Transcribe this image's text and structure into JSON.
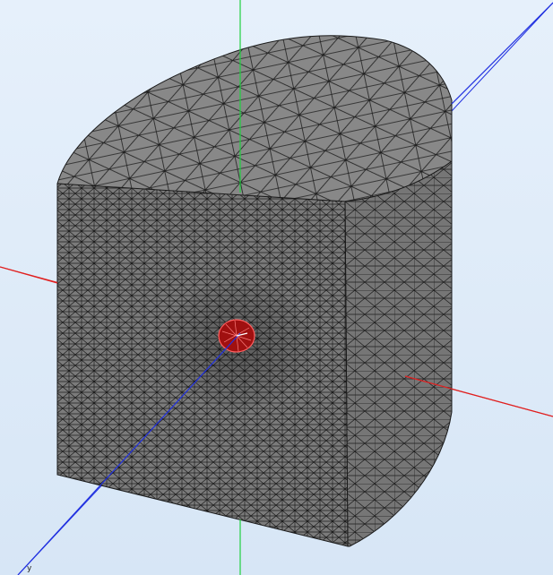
{
  "viewport": {
    "background": "#dde9f7"
  },
  "axes": {
    "x_color": "#e02020",
    "y_color": "#20d040",
    "z_color": "#2030e0",
    "labels": {
      "y_corner": "y"
    }
  },
  "mesh": {
    "surface_color": "#7a7a7a",
    "top_color": "#858585",
    "edge_color": "#1a1a1a",
    "hole_color": "#a01010",
    "hole_edge_color": "#ff6060"
  }
}
